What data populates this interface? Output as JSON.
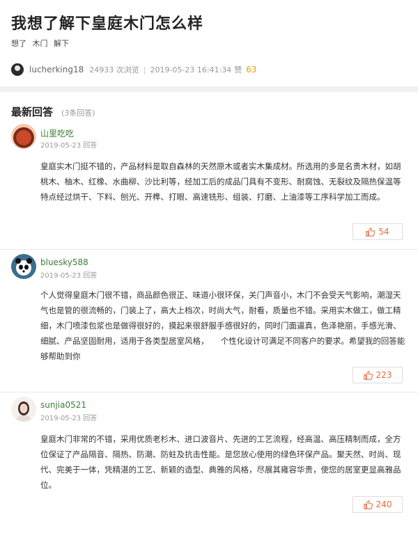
{
  "question": {
    "title": "我想了解下皇庭木门怎么样",
    "tags": [
      "想了",
      "木门",
      "解下"
    ],
    "author": "lucherking18",
    "views": "24933 次浏览",
    "datetime": "2019-05-23 16:41:34",
    "zan_label": "赞",
    "zan_count": "63"
  },
  "answers_header": {
    "title": "最新回答",
    "count": "(3条回答)"
  },
  "answers": [
    {
      "user": "山里吃吃",
      "date": "2019-05-23 回答",
      "text": "皇庭实木门挺不错的，产品材料是取自森林的天然原木或者实木集成材。所选用的多是名贵木材，如胡桃木、柚木、红橡、水曲柳、沙比利等，经加工后的成品门具有不变形、耐腐蚀、无裂纹及隔热保温等特点经过烘干、下料、刨光、开榫、打眼、高速铣形、组装、打磨、上油漆等工序科学加工而成。",
      "likes": "54"
    },
    {
      "user": "bluesky588",
      "date": "2019-05-23 回答",
      "text": "个人觉得皇庭木门很不错，商品颜色很正、味道小很环保，关门声音小，木门不会受天气影响，潮湿天气也是管的很流畅的，门装上了，高大上档次，时尚大气，耐看，质量也不错。采用实木做工，做工精细，木门喷漆包浆也是做得很好的，摸起来很舒服手感很好的，同时门面逼真，色泽艳丽，手感光滑、细腻、产品坚固耐用，适用于各类型居室风格，　　个性化设计可满足不同客户的要求。希望我的回答能够帮助到你",
      "likes": "223"
    },
    {
      "user": "sunjia0521",
      "date": "2019-05-23 回答",
      "text": "皇庭木门非常的不错，采用优质老杉木、进口波音片、先进的工艺流程，经高温、高压精制而成，全方位保证了产品隔音、隔热、防潮、防蛀及抗击性能。是您放心使用的绿色环保产品。聚天然、时尚、现代、完美于一体，凭精湛的工艺、新颖的造型、典雅的风格，尽展其雍容华贵，使您的居室更显高雅品位。",
      "likes": "240"
    }
  ],
  "colors": {
    "username_green": "#3a7e35",
    "like_orange": "#e86a3a",
    "zan_gold": "#e0a30a"
  }
}
